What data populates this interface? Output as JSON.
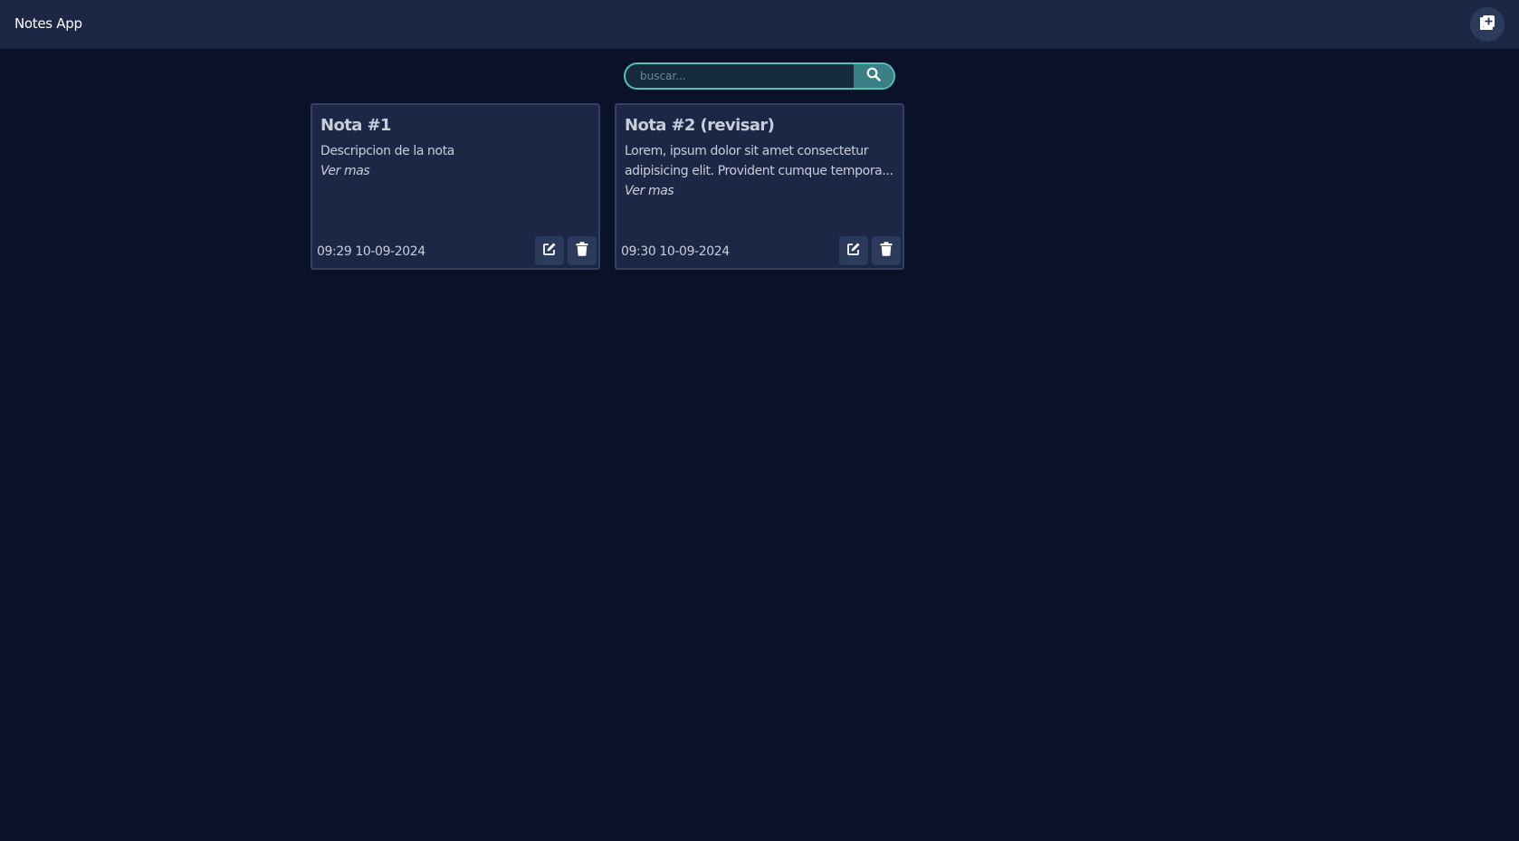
{
  "header": {
    "title": "Notes App",
    "add_icon": "add-note-icon"
  },
  "search": {
    "placeholder": "buscar...",
    "value": "",
    "icon": "search-icon"
  },
  "notes": [
    {
      "title": "Nota #1",
      "description": "Descripcion de la nota",
      "more": "Ver mas",
      "date": "09:29 10-09-2024"
    },
    {
      "title": "Nota #2 (revisar)",
      "description": "Lorem, ipsum dolor sit amet consectetur adipisicing elit. Provident cumque tempora...",
      "more": "Ver mas",
      "date": "09:30 10-09-2024"
    }
  ],
  "colors": {
    "background": "#0a1128",
    "header": "#1c2745",
    "card": "#1c2745",
    "accent": "#4fc3b6",
    "search_button": "#3a7f86"
  }
}
